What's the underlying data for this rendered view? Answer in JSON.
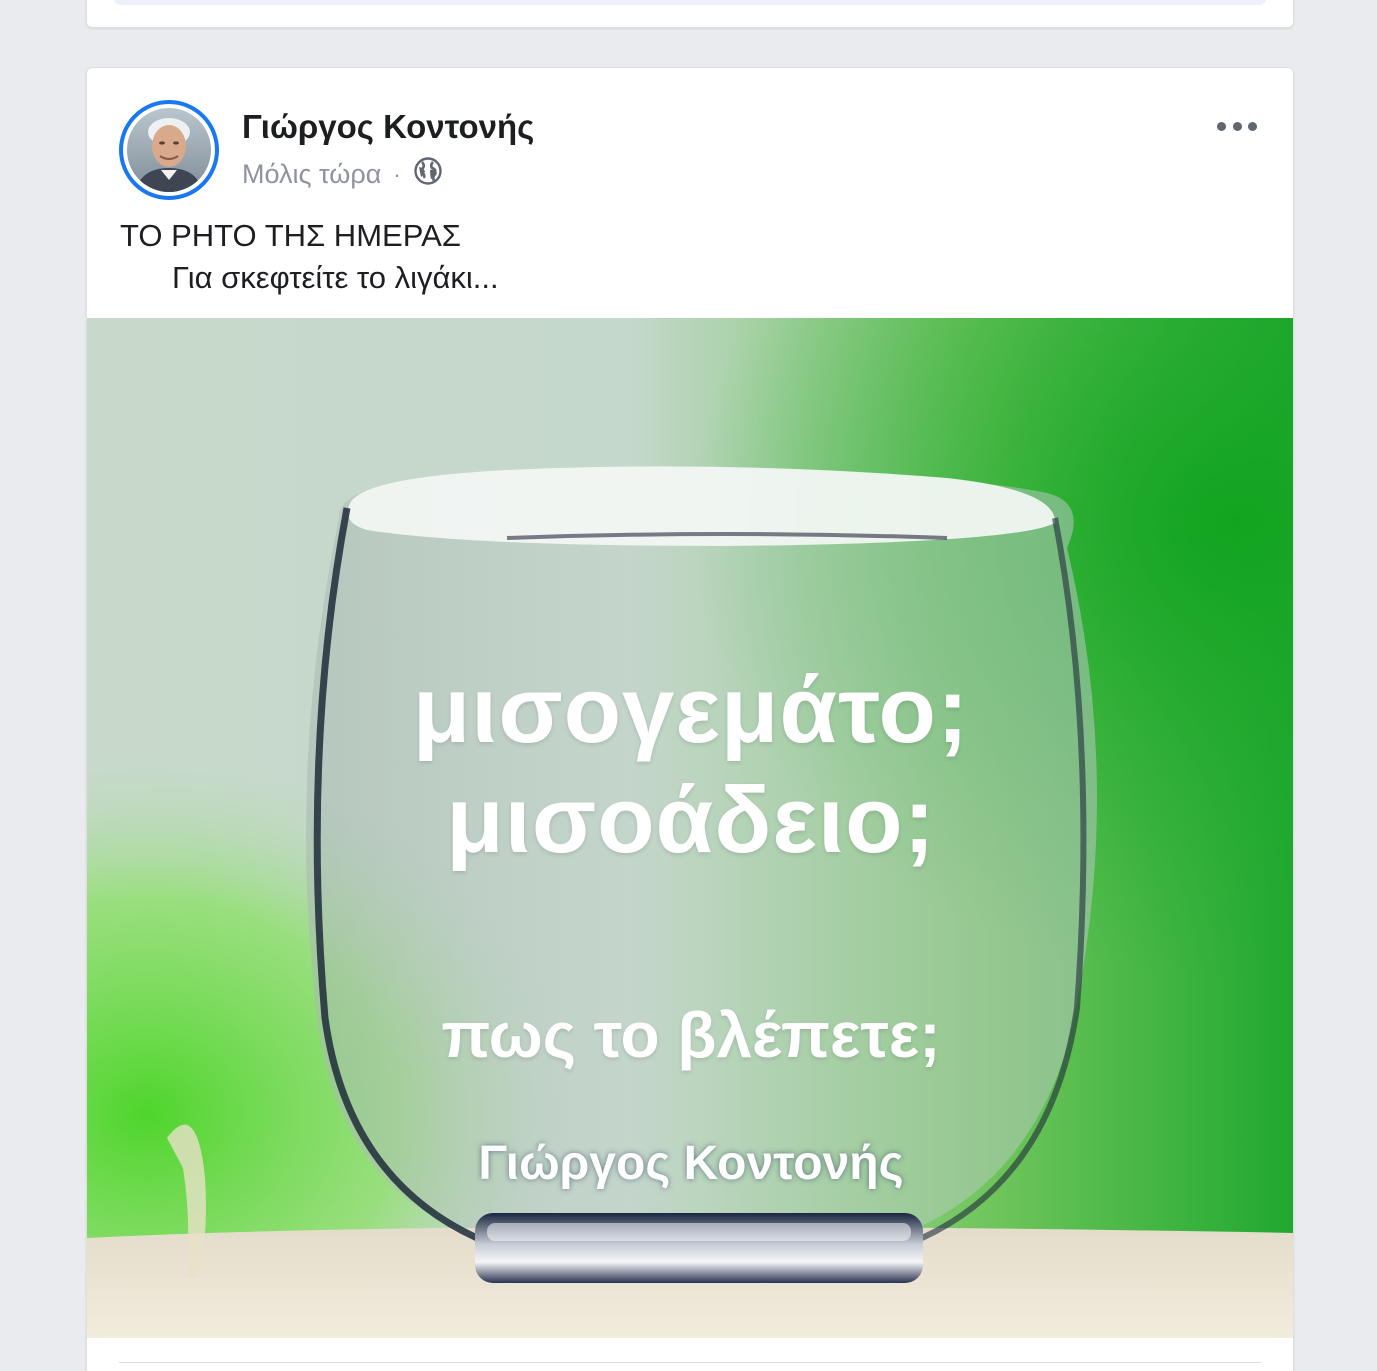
{
  "post": {
    "author_name": "Γιώργος Κοντονής",
    "timestamp": "Μόλις τώρα",
    "separator": "·",
    "privacy_icon": "globe-icon",
    "text_line1": "ΤΟ ΡΗΤΟ ΤΗΣ ΗΜΕΡΑΣ",
    "text_line2": "Για σκεφτείτε το λιγάκι...",
    "image": {
      "line1": "μισογεμάτο;",
      "line2": "μισοάδειο;",
      "line3": "πως το βλέπετε;",
      "signature": "Γιώργος Κοντονής"
    },
    "more_icon": "more-options-icon"
  },
  "colors": {
    "page_bg": "#e9ebee",
    "avatar_ring": "#1877f2",
    "name": "#1c1e21",
    "meta": "#8d949e"
  }
}
